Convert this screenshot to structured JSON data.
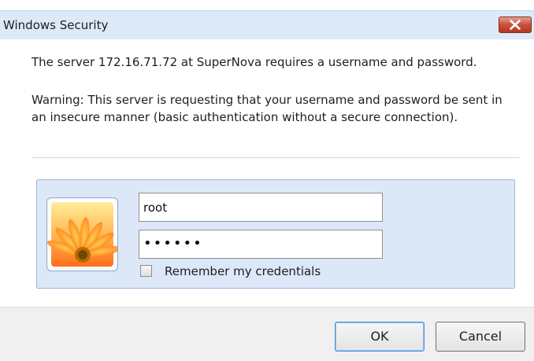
{
  "window": {
    "title": "Windows Security",
    "close_icon": "close-icon"
  },
  "message": {
    "line1": "The server 172.16.71.72 at SuperNova requires a username and password.",
    "warning": "Warning: This server is requesting that your username and password be sent in an insecure manner (basic authentication without a secure connection)."
  },
  "credentials": {
    "username": "root",
    "password_masked": "••••••",
    "remember_label": "Remember my credentials",
    "remember_checked": false
  },
  "buttons": {
    "ok": "OK",
    "cancel": "Cancel"
  },
  "colors": {
    "titlebar": "#dce9f6",
    "panel": "#dce8f7",
    "close_button": "#c9503a"
  }
}
